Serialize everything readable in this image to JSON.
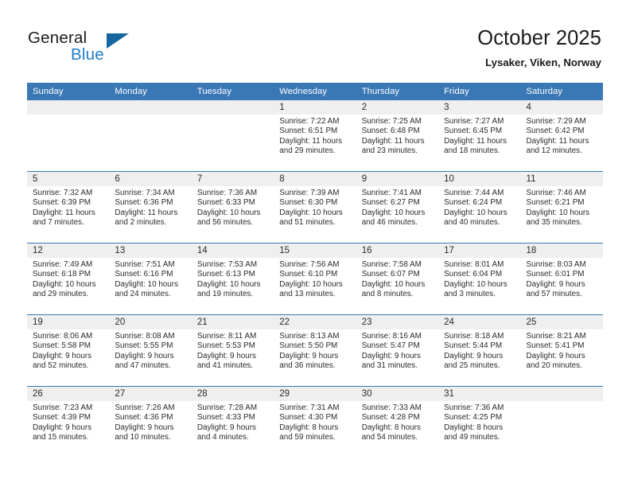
{
  "brand": {
    "name_part1": "General",
    "name_part2": "Blue",
    "logo_icon": "triangle-logo-icon",
    "accent_color": "#1f7cc4",
    "logo_color": "#15669e"
  },
  "header": {
    "title": "October 2025",
    "location": "Lysaker, Viken, Norway"
  },
  "calendar": {
    "header_bg": "#3a78b5",
    "daynum_bg": "#efefef",
    "weekday_headers": [
      "Sunday",
      "Monday",
      "Tuesday",
      "Wednesday",
      "Thursday",
      "Friday",
      "Saturday"
    ],
    "weeks": [
      [
        {
          "day": "",
          "lines": []
        },
        {
          "day": "",
          "lines": []
        },
        {
          "day": "",
          "lines": []
        },
        {
          "day": "1",
          "lines": [
            "Sunrise: 7:22 AM",
            "Sunset: 6:51 PM",
            "Daylight: 11 hours",
            "and 29 minutes."
          ]
        },
        {
          "day": "2",
          "lines": [
            "Sunrise: 7:25 AM",
            "Sunset: 6:48 PM",
            "Daylight: 11 hours",
            "and 23 minutes."
          ]
        },
        {
          "day": "3",
          "lines": [
            "Sunrise: 7:27 AM",
            "Sunset: 6:45 PM",
            "Daylight: 11 hours",
            "and 18 minutes."
          ]
        },
        {
          "day": "4",
          "lines": [
            "Sunrise: 7:29 AM",
            "Sunset: 6:42 PM",
            "Daylight: 11 hours",
            "and 12 minutes."
          ]
        }
      ],
      [
        {
          "day": "5",
          "lines": [
            "Sunrise: 7:32 AM",
            "Sunset: 6:39 PM",
            "Daylight: 11 hours",
            "and 7 minutes."
          ]
        },
        {
          "day": "6",
          "lines": [
            "Sunrise: 7:34 AM",
            "Sunset: 6:36 PM",
            "Daylight: 11 hours",
            "and 2 minutes."
          ]
        },
        {
          "day": "7",
          "lines": [
            "Sunrise: 7:36 AM",
            "Sunset: 6:33 PM",
            "Daylight: 10 hours",
            "and 56 minutes."
          ]
        },
        {
          "day": "8",
          "lines": [
            "Sunrise: 7:39 AM",
            "Sunset: 6:30 PM",
            "Daylight: 10 hours",
            "and 51 minutes."
          ]
        },
        {
          "day": "9",
          "lines": [
            "Sunrise: 7:41 AM",
            "Sunset: 6:27 PM",
            "Daylight: 10 hours",
            "and 46 minutes."
          ]
        },
        {
          "day": "10",
          "lines": [
            "Sunrise: 7:44 AM",
            "Sunset: 6:24 PM",
            "Daylight: 10 hours",
            "and 40 minutes."
          ]
        },
        {
          "day": "11",
          "lines": [
            "Sunrise: 7:46 AM",
            "Sunset: 6:21 PM",
            "Daylight: 10 hours",
            "and 35 minutes."
          ]
        }
      ],
      [
        {
          "day": "12",
          "lines": [
            "Sunrise: 7:49 AM",
            "Sunset: 6:18 PM",
            "Daylight: 10 hours",
            "and 29 minutes."
          ]
        },
        {
          "day": "13",
          "lines": [
            "Sunrise: 7:51 AM",
            "Sunset: 6:16 PM",
            "Daylight: 10 hours",
            "and 24 minutes."
          ]
        },
        {
          "day": "14",
          "lines": [
            "Sunrise: 7:53 AM",
            "Sunset: 6:13 PM",
            "Daylight: 10 hours",
            "and 19 minutes."
          ]
        },
        {
          "day": "15",
          "lines": [
            "Sunrise: 7:56 AM",
            "Sunset: 6:10 PM",
            "Daylight: 10 hours",
            "and 13 minutes."
          ]
        },
        {
          "day": "16",
          "lines": [
            "Sunrise: 7:58 AM",
            "Sunset: 6:07 PM",
            "Daylight: 10 hours",
            "and 8 minutes."
          ]
        },
        {
          "day": "17",
          "lines": [
            "Sunrise: 8:01 AM",
            "Sunset: 6:04 PM",
            "Daylight: 10 hours",
            "and 3 minutes."
          ]
        },
        {
          "day": "18",
          "lines": [
            "Sunrise: 8:03 AM",
            "Sunset: 6:01 PM",
            "Daylight: 9 hours",
            "and 57 minutes."
          ]
        }
      ],
      [
        {
          "day": "19",
          "lines": [
            "Sunrise: 8:06 AM",
            "Sunset: 5:58 PM",
            "Daylight: 9 hours",
            "and 52 minutes."
          ]
        },
        {
          "day": "20",
          "lines": [
            "Sunrise: 8:08 AM",
            "Sunset: 5:55 PM",
            "Daylight: 9 hours",
            "and 47 minutes."
          ]
        },
        {
          "day": "21",
          "lines": [
            "Sunrise: 8:11 AM",
            "Sunset: 5:53 PM",
            "Daylight: 9 hours",
            "and 41 minutes."
          ]
        },
        {
          "day": "22",
          "lines": [
            "Sunrise: 8:13 AM",
            "Sunset: 5:50 PM",
            "Daylight: 9 hours",
            "and 36 minutes."
          ]
        },
        {
          "day": "23",
          "lines": [
            "Sunrise: 8:16 AM",
            "Sunset: 5:47 PM",
            "Daylight: 9 hours",
            "and 31 minutes."
          ]
        },
        {
          "day": "24",
          "lines": [
            "Sunrise: 8:18 AM",
            "Sunset: 5:44 PM",
            "Daylight: 9 hours",
            "and 25 minutes."
          ]
        },
        {
          "day": "25",
          "lines": [
            "Sunrise: 8:21 AM",
            "Sunset: 5:41 PM",
            "Daylight: 9 hours",
            "and 20 minutes."
          ]
        }
      ],
      [
        {
          "day": "26",
          "lines": [
            "Sunrise: 7:23 AM",
            "Sunset: 4:39 PM",
            "Daylight: 9 hours",
            "and 15 minutes."
          ]
        },
        {
          "day": "27",
          "lines": [
            "Sunrise: 7:26 AM",
            "Sunset: 4:36 PM",
            "Daylight: 9 hours",
            "and 10 minutes."
          ]
        },
        {
          "day": "28",
          "lines": [
            "Sunrise: 7:28 AM",
            "Sunset: 4:33 PM",
            "Daylight: 9 hours",
            "and 4 minutes."
          ]
        },
        {
          "day": "29",
          "lines": [
            "Sunrise: 7:31 AM",
            "Sunset: 4:30 PM",
            "Daylight: 8 hours",
            "and 59 minutes."
          ]
        },
        {
          "day": "30",
          "lines": [
            "Sunrise: 7:33 AM",
            "Sunset: 4:28 PM",
            "Daylight: 8 hours",
            "and 54 minutes."
          ]
        },
        {
          "day": "31",
          "lines": [
            "Sunrise: 7:36 AM",
            "Sunset: 4:25 PM",
            "Daylight: 8 hours",
            "and 49 minutes."
          ]
        },
        {
          "day": "",
          "lines": []
        }
      ]
    ]
  }
}
